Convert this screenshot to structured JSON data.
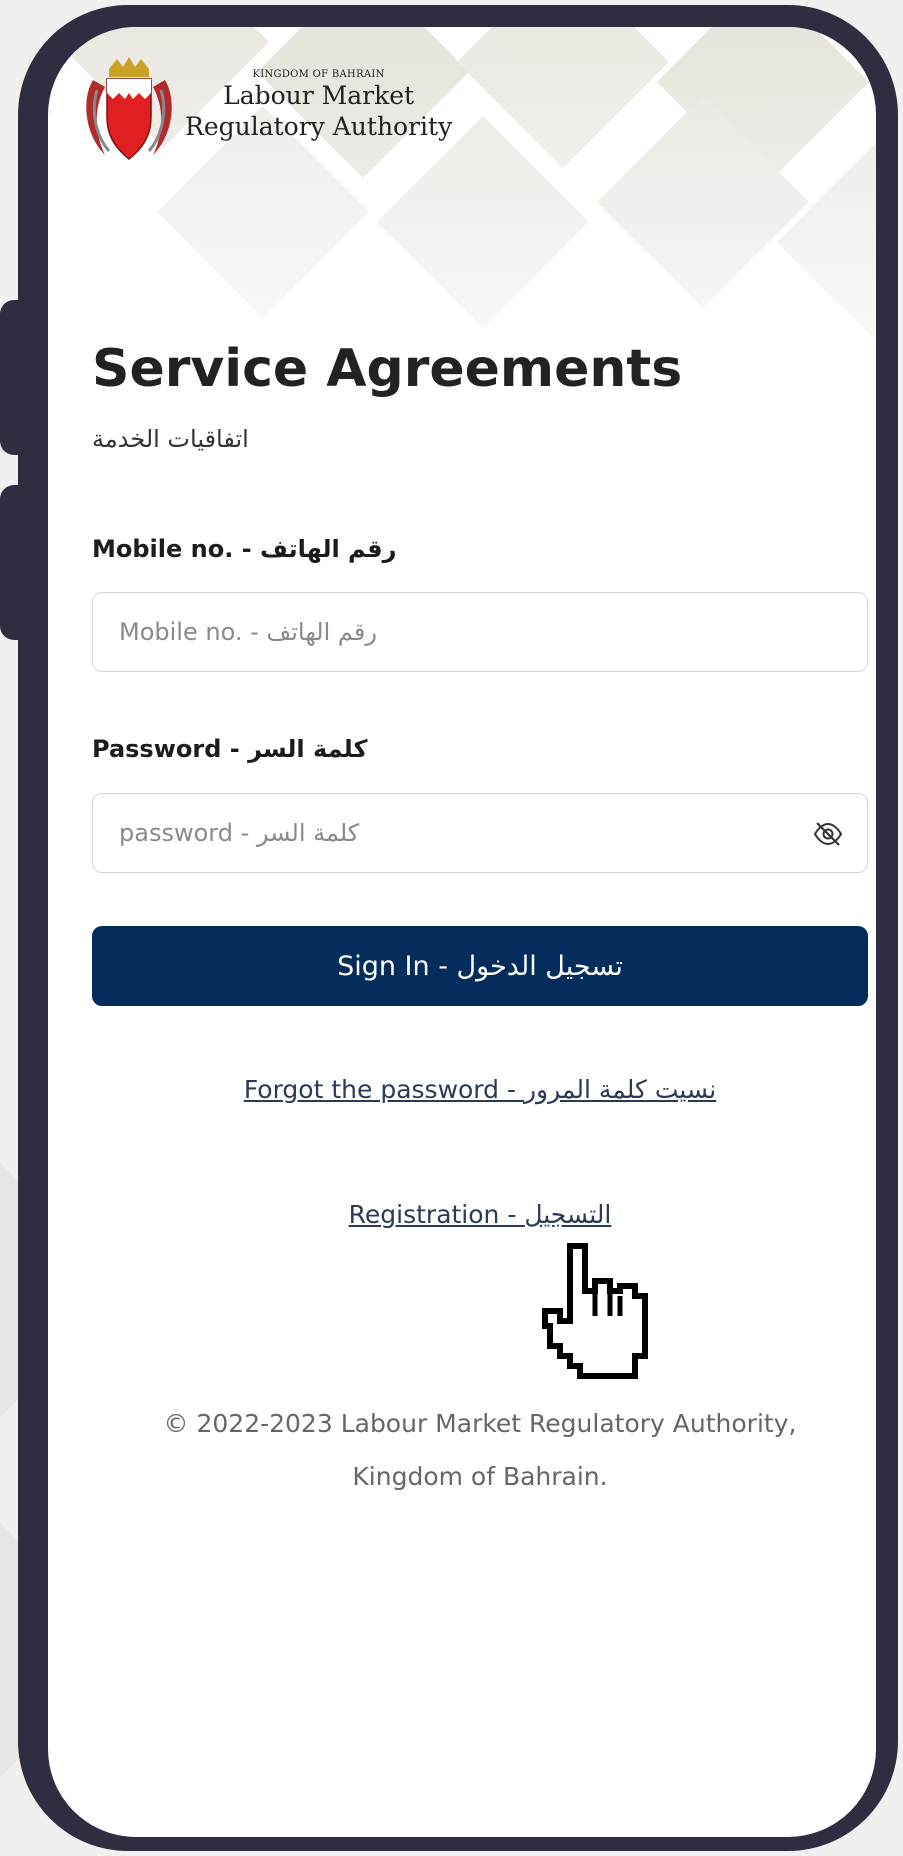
{
  "logo": {
    "line1": "KINGDOM OF BAHRAIN",
    "line2": "Labour Market",
    "line3": "Regulatory Authority"
  },
  "page": {
    "title": "Service Agreements",
    "subtitle": "اتفاقيات الخدمة"
  },
  "form": {
    "mobile_label": "Mobile no. - رقم الهاتف",
    "mobile_placeholder": "Mobile no. - رقم الهاتف",
    "mobile_value": "",
    "password_label": "Password - كلمة السر",
    "password_placeholder": "password - كلمة السر",
    "password_value": "",
    "password_toggle_icon": "eye-slash-icon",
    "signin_label": "Sign In - تسجيل الدخول"
  },
  "links": {
    "forgot": "Forgot the password - نسيت كلمة المرور",
    "register": "Registration - التسجيل"
  },
  "footer": {
    "line1": "© 2022-2023 Labour Market Regulatory Authority,",
    "line2": "Kingdom of Bahrain."
  },
  "colors": {
    "primary_button": "#052d5c",
    "phone_frame": "#2f2e41",
    "link": "#2b3a55"
  },
  "overlay": {
    "cursor_icon": "hand-pointer-icon"
  }
}
